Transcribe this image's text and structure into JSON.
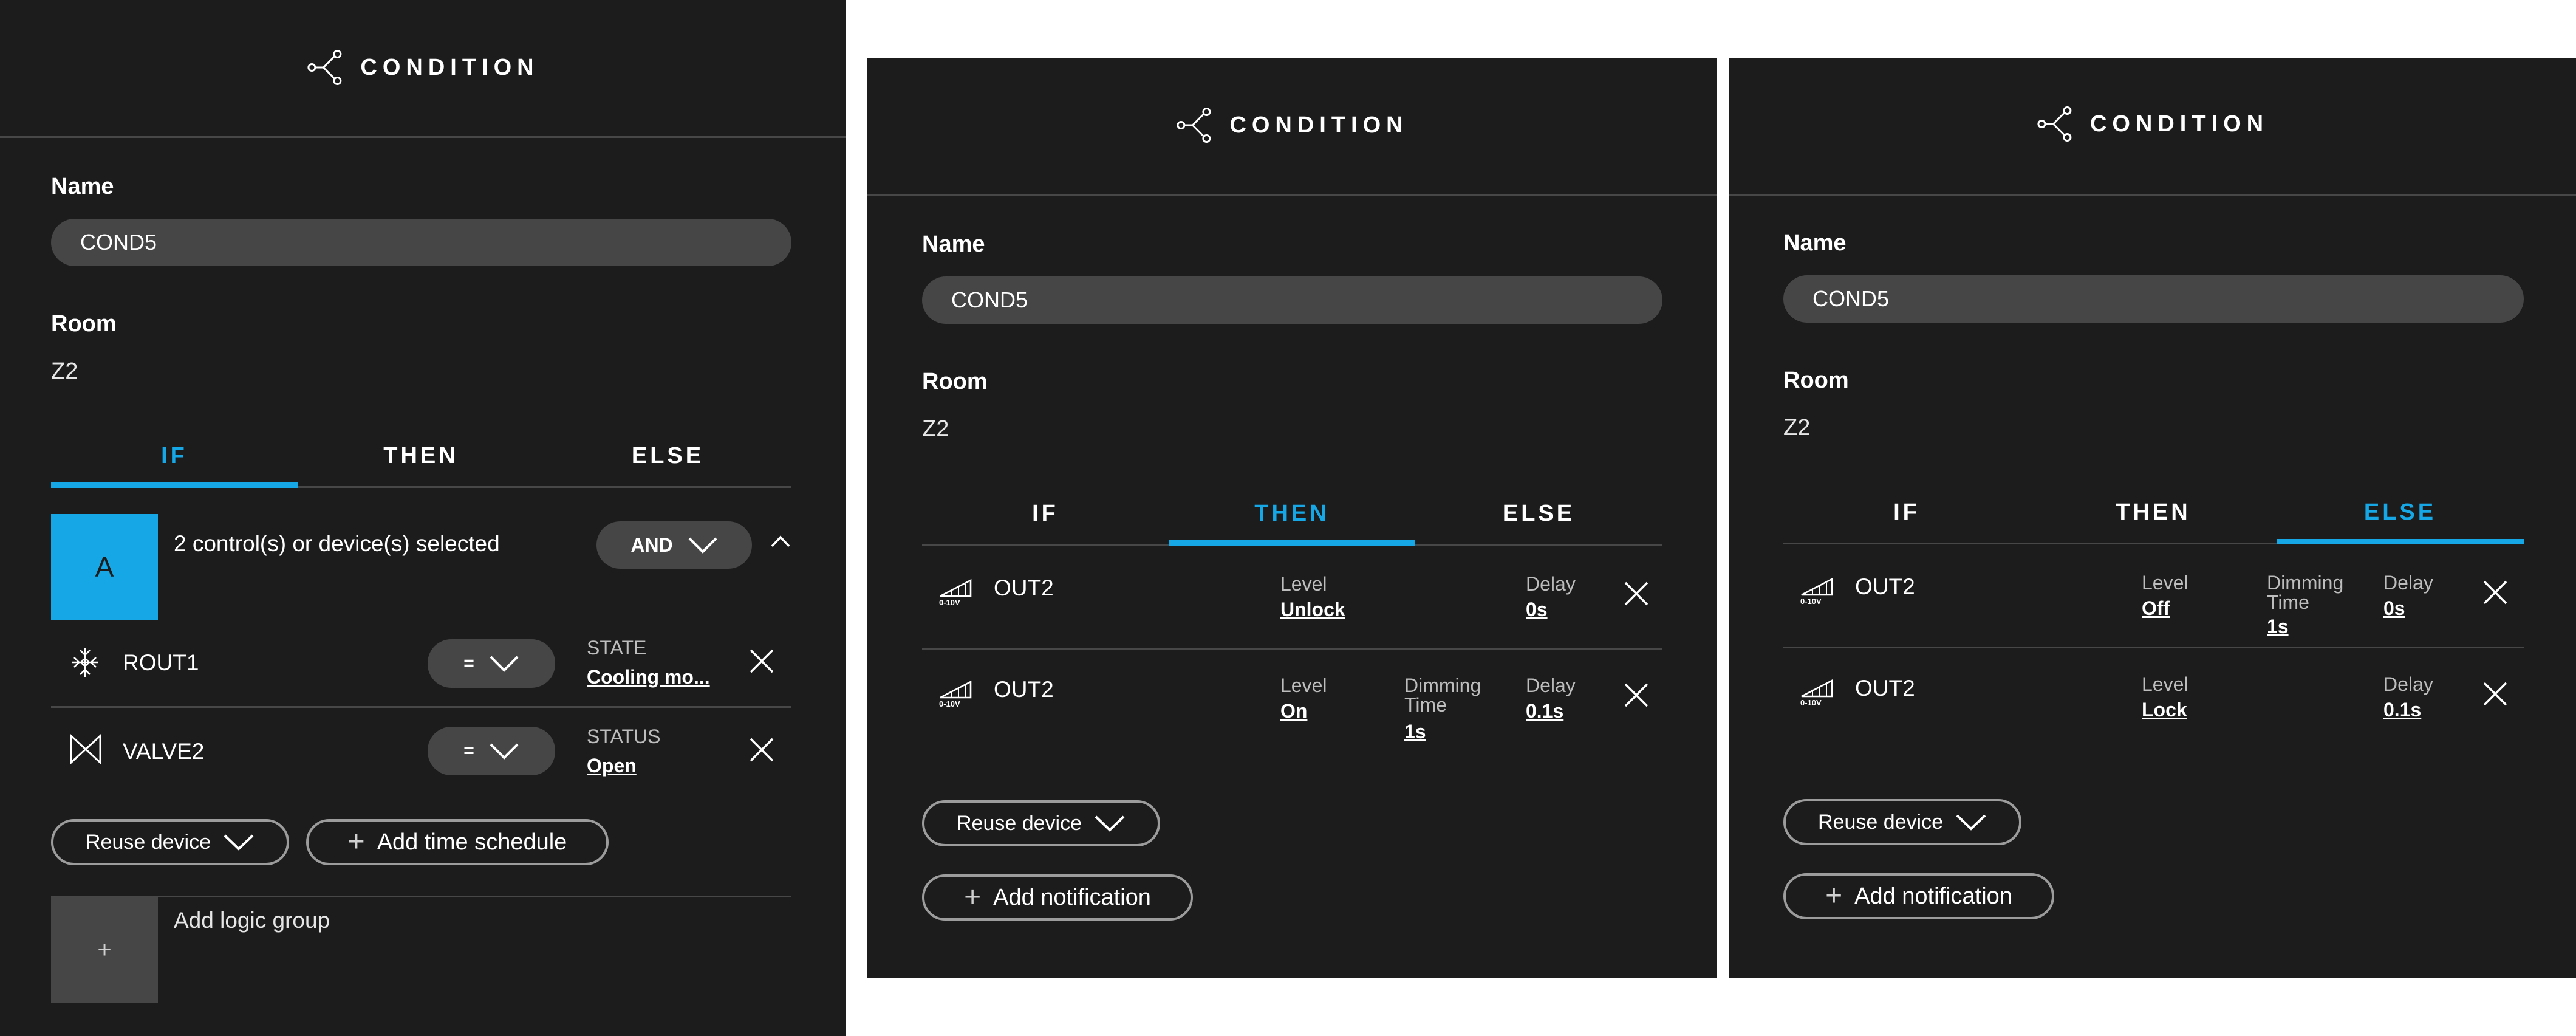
{
  "panel_left": {
    "header": {
      "title": "CONDITION",
      "icon": "branch-icon"
    },
    "name_label": "Name",
    "name_value": "COND5",
    "room_label": "Room",
    "room_value": "Z2",
    "tabs": [
      {
        "label": "IF",
        "active": true
      },
      {
        "label": "THEN",
        "active": false
      },
      {
        "label": "ELSE",
        "active": false
      }
    ],
    "group": {
      "letter": "A",
      "summary": "2 control(s) or device(s) selected",
      "operator": "AND"
    },
    "conditions": [
      {
        "icon": "thermostat-icon",
        "name": "ROUT1",
        "comparator": "=",
        "field_label": "STATE",
        "field_value": "Cooling mo..."
      },
      {
        "icon": "valve-icon",
        "name": "VALVE2",
        "comparator": "=",
        "field_label": "STATUS",
        "field_value": "Open"
      }
    ],
    "reuse_device": "Reuse device",
    "add_time_schedule": "Add time schedule",
    "add_logic_group": "Add logic group",
    "add_logic_group_symbol": "+"
  },
  "panel_mid": {
    "header": {
      "title": "CONDITION",
      "icon": "branch-icon"
    },
    "name_label": "Name",
    "name_value": "COND5",
    "room_label": "Room",
    "room_value": "Z2",
    "tabs": [
      {
        "label": "IF",
        "active": false
      },
      {
        "label": "THEN",
        "active": true
      },
      {
        "label": "ELSE",
        "active": false
      }
    ],
    "actions": [
      {
        "icon": "dimmer-0-10v-icon",
        "icon_text": "0-10V",
        "name": "OUT2",
        "level_label": "Level",
        "level_value": "Unlock",
        "delay_label": "Delay",
        "delay_value": "0s"
      },
      {
        "icon": "dimmer-0-10v-icon",
        "icon_text": "0-10V",
        "name": "OUT2",
        "level_label": "Level",
        "level_value": "On",
        "dim_label_1": "Dimming",
        "dim_label_2": "Time",
        "dim_value": "1s",
        "delay_label": "Delay",
        "delay_value": "0.1s"
      }
    ],
    "reuse_device": "Reuse device",
    "add_notification": "Add notification"
  },
  "panel_right": {
    "header": {
      "title": "CONDITION",
      "icon": "branch-icon"
    },
    "name_label": "Name",
    "name_value": "COND5",
    "room_label": "Room",
    "room_value": "Z2",
    "tabs": [
      {
        "label": "IF",
        "active": false
      },
      {
        "label": "THEN",
        "active": false
      },
      {
        "label": "ELSE",
        "active": true
      }
    ],
    "actions": [
      {
        "icon": "dimmer-0-10v-icon",
        "icon_text": "0-10V",
        "name": "OUT2",
        "level_label": "Level",
        "level_value": "Off",
        "dim_label_1": "Dimming",
        "dim_label_2": "Time",
        "dim_value": "1s",
        "delay_label": "Delay",
        "delay_value": "0s"
      },
      {
        "icon": "dimmer-0-10v-icon",
        "icon_text": "0-10V",
        "name": "OUT2",
        "level_label": "Level",
        "level_value": "Lock",
        "delay_label": "Delay",
        "delay_value": "0.1s"
      }
    ],
    "reuse_device": "Reuse device",
    "add_notification": "Add notification"
  },
  "colors": {
    "panel_bg": "#1c1c1c",
    "accent": "#15a7e6",
    "pill_bg": "#464646",
    "divider": "#474747"
  }
}
